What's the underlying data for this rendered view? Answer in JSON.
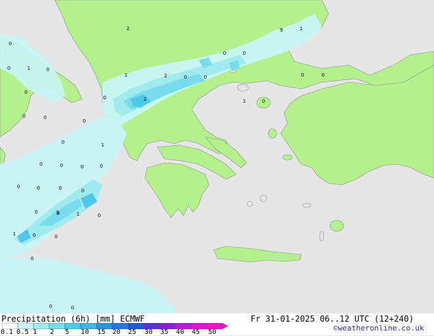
{
  "footer": {
    "title": "Precipitation (6h) [mm] ECMWF",
    "datetime": "Fr 31-01-2025 06..12 UTC (12+240)",
    "credit": "©weatheronline.co.uk"
  },
  "legend": {
    "ticks": [
      "0.1",
      "0.5",
      "1",
      "2",
      "5",
      "10",
      "15",
      "20",
      "25",
      "30",
      "35",
      "40",
      "45",
      "50"
    ],
    "colors": [
      "#ffffff",
      "#c8f5f5",
      "#a0ebf0",
      "#78dcec",
      "#50c8e8",
      "#3cb4e6",
      "#2896dc",
      "#2878dc",
      "#1e5ad2",
      "#5a32d2",
      "#8c1ed2",
      "#b41ed2",
      "#dc14d2",
      "#f014c8"
    ]
  },
  "map_labels": [
    "2",
    "9",
    "1",
    "0",
    "0",
    "0",
    "0",
    "1",
    "0",
    "1",
    "2",
    "0",
    "0",
    "0",
    "0",
    "2",
    "0",
    "1",
    "0",
    "0",
    "0",
    "0",
    "0",
    "0",
    "0",
    "0",
    "1",
    "0",
    "0",
    "0",
    "0",
    "0",
    "0",
    "0",
    "0",
    "3",
    "1",
    "0",
    "1",
    "0",
    "0",
    "0",
    "0",
    "0"
  ],
  "colors": {
    "land": "#b4f08c",
    "sea": "#e6e6e6",
    "precip_light": "#c8f5f5",
    "precip_mid": "#a0ebf0",
    "precip_heavy": "#78dcec",
    "precip_max": "#50c8e8"
  }
}
